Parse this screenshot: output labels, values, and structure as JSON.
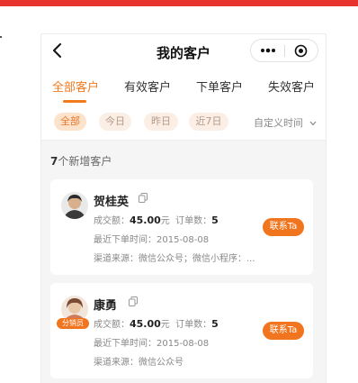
{
  "header": {
    "title": "我的客户"
  },
  "tabs": [
    {
      "label": "全部客户",
      "active": true
    },
    {
      "label": "有效客户",
      "active": false
    },
    {
      "label": "下单客户",
      "active": false
    },
    {
      "label": "失效客户",
      "active": false
    }
  ],
  "filters": {
    "chips": [
      {
        "label": "全部",
        "active": true
      },
      {
        "label": "今日",
        "active": false
      },
      {
        "label": "昨日",
        "active": false
      },
      {
        "label": "近7日",
        "active": false
      }
    ],
    "custom_time": "自定义时间"
  },
  "section": {
    "count": "7",
    "label": "个新增客户"
  },
  "customers": [
    {
      "name": "贺桂英",
      "amount_label": "成交额：",
      "amount": "45.00",
      "amount_unit": "元",
      "orders_label": "订单数：",
      "orders": "5",
      "last_order_label": "最近下单时间：",
      "last_order": "2015-08-08",
      "channel_label": "渠道来源：",
      "channel": "微信公众号；微信小程序：...",
      "contact_label": "联系Ta"
    },
    {
      "name": "康勇",
      "badge": "分销员",
      "amount_label": "成交额：",
      "amount": "45.00",
      "amount_unit": "元",
      "orders_label": "订单数：",
      "orders": "5",
      "last_order_label": "最近下单时间：",
      "last_order": "2015-08-08",
      "channel_label": "渠道来源：",
      "channel": "微信公众号",
      "contact_label": "联系Ta"
    }
  ],
  "colors": {
    "accent": "#f07a1e",
    "top_bar": "#e8342f"
  }
}
